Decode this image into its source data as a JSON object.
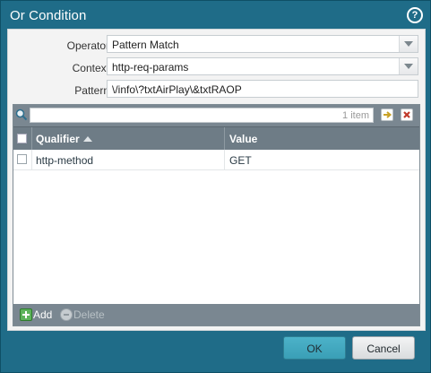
{
  "dialog": {
    "title": "Or Condition",
    "help_icon_glyph": "?"
  },
  "form": {
    "operator": {
      "label": "Operator",
      "value": "Pattern Match"
    },
    "context": {
      "label": "Context",
      "value": "http-req-params"
    },
    "pattern": {
      "label": "Pattern",
      "value": "\\/info\\?txtAirPlay\\&txtRAOP"
    }
  },
  "grid": {
    "search": {
      "count_text": "1 item"
    },
    "columns": [
      "Qualifier",
      "Value"
    ],
    "sort_column": "Qualifier",
    "sort_direction": "ascending",
    "rows": [
      {
        "qualifier": "http-method",
        "value": "GET"
      }
    ],
    "footer": {
      "add_label": "Add",
      "delete_label": "Delete"
    }
  },
  "buttons": {
    "ok": "OK",
    "cancel": "Cancel"
  },
  "colors": {
    "title_bar": "#1f6c88",
    "toolbar": "#7a8791",
    "header": "#6e7c86",
    "ok_button": "#3a9fb6",
    "add_icon": "#5db35b",
    "clear_icon": "#c0392b",
    "apply_icon": "#c9a227"
  }
}
